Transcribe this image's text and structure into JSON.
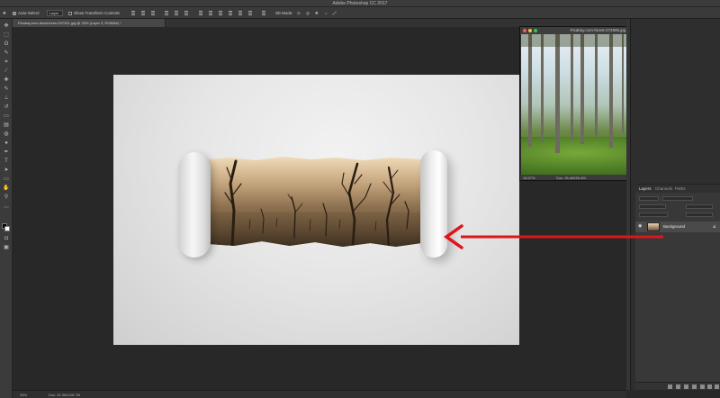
{
  "app": {
    "title": "Adobe Photoshop CC 2017"
  },
  "options_bar": {
    "auto_select_label": "Auto-Select:",
    "auto_select_value": "Layer",
    "show_transform_label": "Show Transform Controls"
  },
  "document": {
    "tab_label": "Pixabay.com-dead-trees-947331.jpg @ 33% (Layer 3, RGB/8#) *",
    "zoom": "33%",
    "doc_size": "Doc: 51.0M/108.7M"
  },
  "floating_window": {
    "title": "Pixabay.com-forest-272595.jpg @ 16.7% (RGB/8#) *",
    "zoom": "16.67%",
    "doc_size": "Doc: 26.4M/26.4M"
  },
  "layers_panel": {
    "tabs": [
      "Layers",
      "Channels",
      "Paths"
    ],
    "active_tab": "Layers",
    "layer_name": "Background"
  },
  "colors": {
    "annotation_arrow": "#e0141b",
    "canvas_bg": "#282828",
    "panel_bg": "#383838"
  },
  "icons": {
    "visibility": "eye-icon",
    "lock": "lock-icon"
  }
}
